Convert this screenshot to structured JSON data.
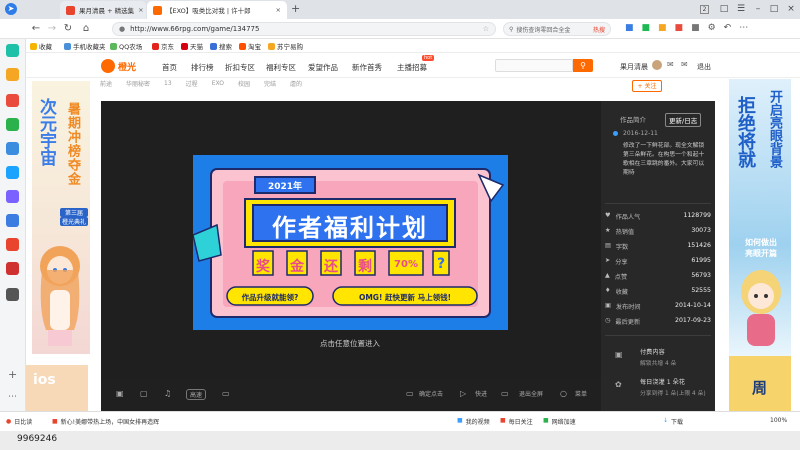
{
  "browser": {
    "tabs": [
      {
        "label": "果月清晨 + 精选集",
        "active": false,
        "color": "#e8442e"
      },
      {
        "label": "【EXO】吸类比对我 | 许十郎",
        "active": true,
        "color": "#ff6a00"
      },
      {
        "label": "...",
        "active": false,
        "color": "#999999"
      }
    ],
    "url": "http://www.66rpg.com/game/134775",
    "search_placeholder": "搜伤查询零回合全金",
    "search_tag": "热搜",
    "window_badge": "2"
  },
  "bookmarks": [
    "收藏",
    "手机收藏夹",
    "QQ农场",
    "京东",
    "天猫",
    "搜索",
    "淘宝",
    "苏宁易购"
  ],
  "site": {
    "logo": "橙光",
    "nav": [
      "首页",
      "排行榜",
      "折扣专区",
      "福利专区",
      "爱望作品",
      "新作首秀",
      "主播招募"
    ],
    "nav_badge": "hot",
    "user": "果月清晨",
    "logout": "退出",
    "subnav": [
      "前途",
      "华丽秘密",
      "13",
      "过程",
      "EXO",
      "校园",
      "完结",
      "虐的"
    ],
    "follow": "+ 关注"
  },
  "left_ad": {
    "lines": [
      "暑期冲榜夺金",
      "次元宇宙",
      "第三届",
      "橙光典礼"
    ],
    "bottom": "ios"
  },
  "right_ad": {
    "lines": [
      "拒绝将就",
      "开启亮眼背景",
      "如何做出",
      "亮眼开篇"
    ],
    "bottom": "周"
  },
  "player": {
    "banner_year": "2021年",
    "banner_title": "作者福利计划",
    "banner_chars": [
      "奖",
      "金",
      "还",
      "剩",
      "70%",
      "?"
    ],
    "banner_q": "作品升级就能领?",
    "banner_cta": "OMG! 赶快更新 马上领钱!",
    "enter_hint": "点击任意位置进入",
    "controls": {
      "speed": "高速",
      "confirm": "确定点击",
      "fast": "快进",
      "exit": "退出全屏",
      "menu": "菜单"
    }
  },
  "info": {
    "tab1": "作品简介",
    "tab2": "更新/日志",
    "date": "2016-12-11",
    "desc": "修改了一下鲜花部。现全文解锁第三朵鲜花。在构思一个和起十歌相在三章跳的番外。大家可以期待",
    "stats": [
      {
        "icon": "heart-icon",
        "label": "作品人气",
        "value": "1128799"
      },
      {
        "icon": "star-icon",
        "label": "热销值",
        "value": "30073"
      },
      {
        "icon": "text-icon",
        "label": "字数",
        "value": "151426"
      },
      {
        "icon": "share-icon",
        "label": "分享",
        "value": "61995"
      },
      {
        "icon": "thumb-icon",
        "label": "点赞",
        "value": "56793"
      },
      {
        "icon": "bookmark-icon",
        "label": "收藏",
        "value": "52555"
      },
      {
        "icon": "calendar-icon",
        "label": "发布时间",
        "value": "2014-10-14"
      },
      {
        "icon": "clock-icon",
        "label": "最后更新",
        "value": "2017-09-23"
      }
    ],
    "paid_title": "付费内容",
    "paid_sub": "解锁共增 4 朵",
    "flower_title": "每日浇灌 1 朵花",
    "flower_sub": "分享到得 1 朵(上限 4 朵)"
  },
  "statusbar": {
    "item1": "日比读",
    "news": "新心!美娜带热上场，中国女排再造辉",
    "items": [
      "我的视频",
      "每日关注",
      "网络加速",
      "下载"
    ],
    "zoom": "100%"
  },
  "bottom_text": "9969246"
}
